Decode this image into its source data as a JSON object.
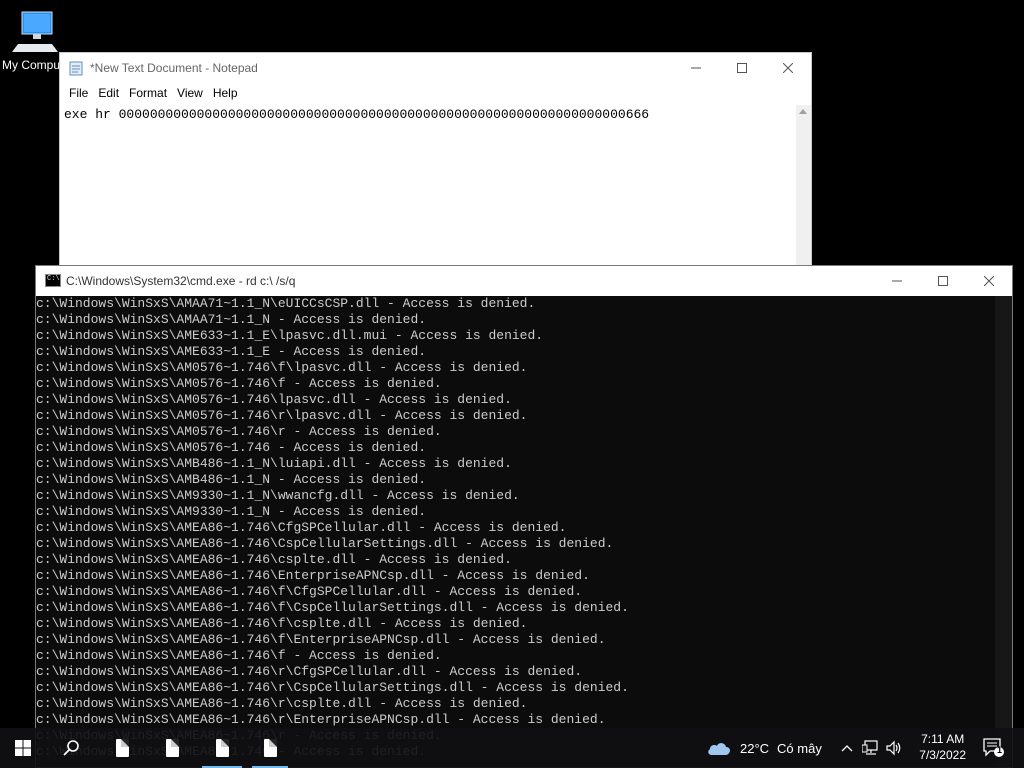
{
  "desktop": {
    "icon_label": "My Compu"
  },
  "notepad": {
    "title": "*New Text Document - Notepad",
    "menu": [
      "File",
      "Edit",
      "Format",
      "View",
      "Help"
    ],
    "content": "exe hr 00000000000000000000000000000000000000000000000000000000000000000666"
  },
  "cmd": {
    "title": "C:\\Windows\\System32\\cmd.exe - rd  c:\\ /s/q",
    "lines": [
      "c:\\Windows\\WinSxS\\AMAA71~1.1_N\\eUICCsCSP.dll - Access is denied.",
      "c:\\Windows\\WinSxS\\AMAA71~1.1_N - Access is denied.",
      "c:\\Windows\\WinSxS\\AME633~1.1_E\\lpasvc.dll.mui - Access is denied.",
      "c:\\Windows\\WinSxS\\AME633~1.1_E - Access is denied.",
      "c:\\Windows\\WinSxS\\AM0576~1.746\\f\\lpasvc.dll - Access is denied.",
      "c:\\Windows\\WinSxS\\AM0576~1.746\\f - Access is denied.",
      "c:\\Windows\\WinSxS\\AM0576~1.746\\lpasvc.dll - Access is denied.",
      "c:\\Windows\\WinSxS\\AM0576~1.746\\r\\lpasvc.dll - Access is denied.",
      "c:\\Windows\\WinSxS\\AM0576~1.746\\r - Access is denied.",
      "c:\\Windows\\WinSxS\\AM0576~1.746 - Access is denied.",
      "c:\\Windows\\WinSxS\\AMB486~1.1_N\\luiapi.dll - Access is denied.",
      "c:\\Windows\\WinSxS\\AMB486~1.1_N - Access is denied.",
      "c:\\Windows\\WinSxS\\AM9330~1.1_N\\wwancfg.dll - Access is denied.",
      "c:\\Windows\\WinSxS\\AM9330~1.1_N - Access is denied.",
      "c:\\Windows\\WinSxS\\AMEA86~1.746\\CfgSPCellular.dll - Access is denied.",
      "c:\\Windows\\WinSxS\\AMEA86~1.746\\CspCellularSettings.dll - Access is denied.",
      "c:\\Windows\\WinSxS\\AMEA86~1.746\\csplte.dll - Access is denied.",
      "c:\\Windows\\WinSxS\\AMEA86~1.746\\EnterpriseAPNCsp.dll - Access is denied.",
      "c:\\Windows\\WinSxS\\AMEA86~1.746\\f\\CfgSPCellular.dll - Access is denied.",
      "c:\\Windows\\WinSxS\\AMEA86~1.746\\f\\CspCellularSettings.dll - Access is denied.",
      "c:\\Windows\\WinSxS\\AMEA86~1.746\\f\\csplte.dll - Access is denied.",
      "c:\\Windows\\WinSxS\\AMEA86~1.746\\f\\EnterpriseAPNCsp.dll - Access is denied.",
      "c:\\Windows\\WinSxS\\AMEA86~1.746\\f - Access is denied.",
      "c:\\Windows\\WinSxS\\AMEA86~1.746\\r\\CfgSPCellular.dll - Access is denied.",
      "c:\\Windows\\WinSxS\\AMEA86~1.746\\r\\CspCellularSettings.dll - Access is denied.",
      "c:\\Windows\\WinSxS\\AMEA86~1.746\\r\\csplte.dll - Access is denied.",
      "c:\\Windows\\WinSxS\\AMEA86~1.746\\r\\EnterpriseAPNCsp.dll - Access is denied.",
      "c:\\Windows\\WinSxS\\AMEA86~1.746\\r - Access is denied.",
      "c:\\Windows\\WinSxS\\AMEA86~1.746 - Access is denied."
    ]
  },
  "taskbar": {
    "weather_temp": "22°C",
    "weather_desc": "Có mây",
    "time": "7:11 AM",
    "date": "7/3/2022",
    "notification_count": "1"
  },
  "colors": {
    "cmd_bg": "#0c0c0c",
    "cmd_text": "#cccccc",
    "taskbar_active": "#76b9ed"
  }
}
